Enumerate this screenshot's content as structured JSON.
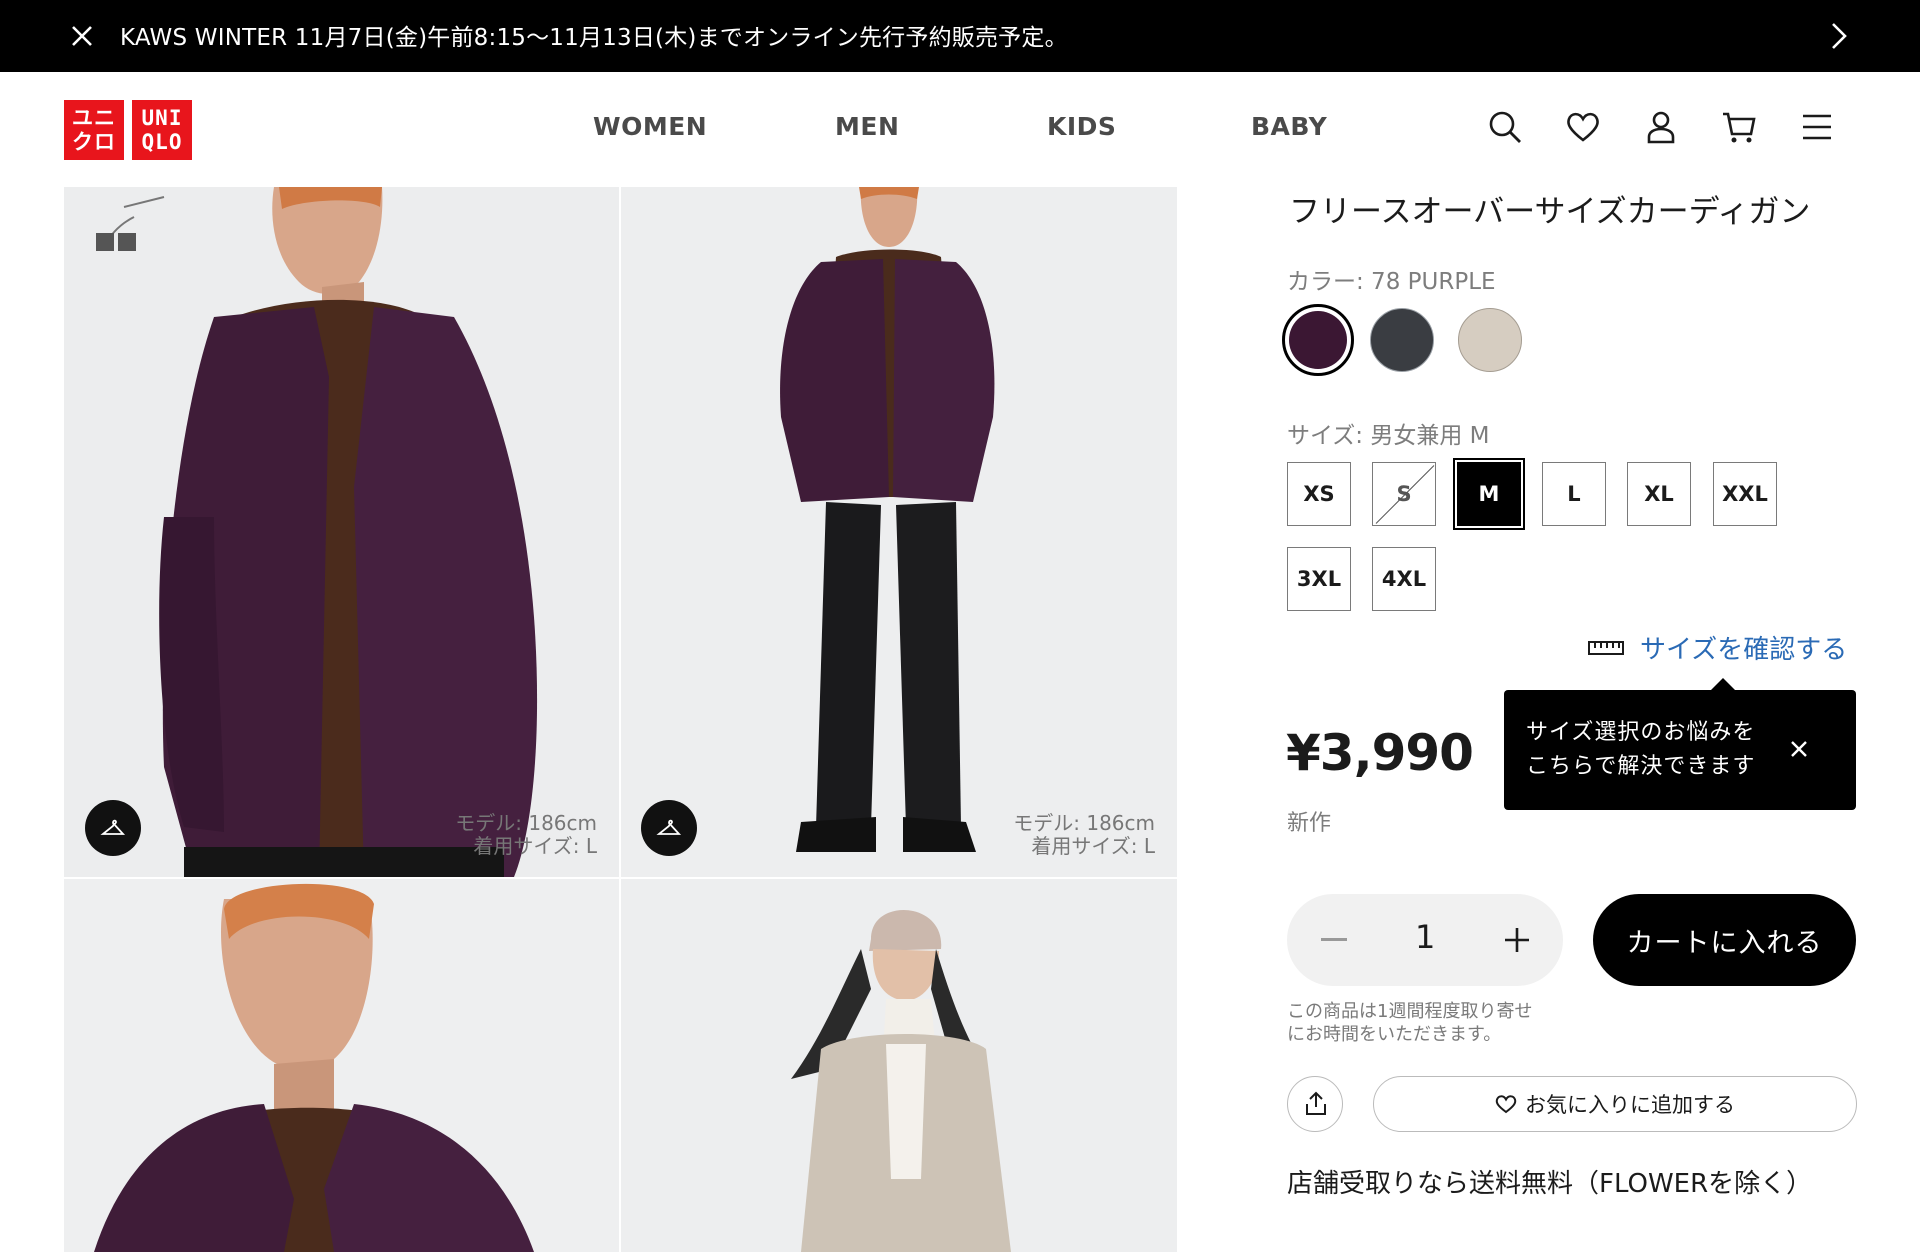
{
  "promo": {
    "message": "KAWS WINTER 11月7日(金)午前8:15～11月13日(木)までオンライン先行予約販売予定。",
    "close_icon": "close-icon",
    "next_icon": "chevron-right-icon"
  },
  "header": {
    "logo": {
      "tile1_line1": "ユニ",
      "tile1_line2": "クロ",
      "tile2_line1": "UNI",
      "tile2_line2": "QLO",
      "color": "#e8151c"
    },
    "nav": [
      "WOMEN",
      "MEN",
      "KIDS",
      "BABY"
    ],
    "icons": [
      "search-icon",
      "heart-icon",
      "account-icon",
      "cart-icon",
      "menu-icon"
    ]
  },
  "gallery": {
    "photos": [
      {
        "subject": "model-closeup-purple-cardigan",
        "model_height": "モデル: 186cm",
        "size_worn": "着用サイズ: L"
      },
      {
        "subject": "model-fullbody-purple-cardigan",
        "model_height": "モデル: 186cm",
        "size_worn": "着用サイズ: L"
      },
      {
        "subject": "model-portrait-purple-cardigan"
      },
      {
        "subject": "model-beige-cardigan"
      }
    ]
  },
  "product": {
    "title": "フリースオーバーサイズカーディガン",
    "color_label": "カラー: 78 PURPLE",
    "colors": [
      {
        "name": "78 PURPLE",
        "hex": "#3b1733",
        "selected": true
      },
      {
        "name": "GRAY",
        "hex": "#3a3d42",
        "selected": false
      },
      {
        "name": "BEIGE",
        "hex": "#d6cdc1",
        "selected": false
      }
    ],
    "size_label": "サイズ: 男女兼用 M",
    "sizes": [
      {
        "label": "XS",
        "state": "available"
      },
      {
        "label": "S",
        "state": "unavailable"
      },
      {
        "label": "M",
        "state": "selected"
      },
      {
        "label": "L",
        "state": "available"
      },
      {
        "label": "XL",
        "state": "available"
      },
      {
        "label": "XXL",
        "state": "available"
      },
      {
        "label": "3XL",
        "state": "available"
      },
      {
        "label": "4XL",
        "state": "available"
      }
    ],
    "size_check_link": "サイズを確認する",
    "tooltip_line1": "サイズ選択のお悩みを",
    "tooltip_line2": "こちらで解決できます",
    "price": "¥3,990",
    "badge": "新作",
    "quantity": "1",
    "add_to_cart": "カートに入れる",
    "order_note_line1": "この商品は1週間程度取り寄せ",
    "order_note_line2": "にお時間をいただきます。",
    "favorite_label": "お気に入りに追加する",
    "pickup_note": "店舗受取りなら送料無料（FLOWERを除く）"
  }
}
